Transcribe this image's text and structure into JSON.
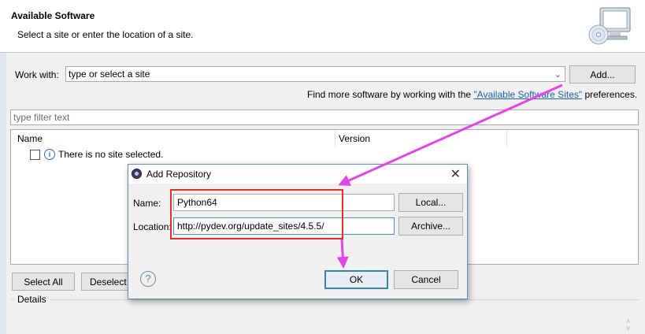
{
  "banner": {
    "title": "Available Software",
    "description": "Select a site or enter the location of a site."
  },
  "work_with": {
    "label": "Work with:",
    "combo_value": "type or select a site",
    "add_button": "Add..."
  },
  "find_more": {
    "prefix": "Find more software by working with the ",
    "link": "\"Available Software Sites\"",
    "suffix": " preferences."
  },
  "filter": {
    "placeholder": "type filter text"
  },
  "table": {
    "columns": [
      "Name",
      "Version"
    ],
    "rows": [
      {
        "label": "There is no site selected."
      }
    ]
  },
  "bottom_buttons": {
    "select_all": "Select All",
    "deselect": "Deselect"
  },
  "details": {
    "label": "Details"
  },
  "dialog": {
    "title": "Add Repository",
    "name_label": "Name:",
    "name_value": "Python64",
    "location_label": "Location:",
    "location_value": "http://pydev.org/update_sites/4.5.5/",
    "local_button": "Local...",
    "archive_button": "Archive...",
    "ok_button": "OK",
    "cancel_button": "Cancel"
  },
  "colors": {
    "annotation_arrow": "#e542e8",
    "annotation_box": "#e0302b",
    "link": "#1a5fb4"
  },
  "icons": [
    "cd-monitor-icon",
    "info-icon",
    "help-icon",
    "close-icon",
    "chevron-down-icon",
    "eclipse-icon"
  ]
}
